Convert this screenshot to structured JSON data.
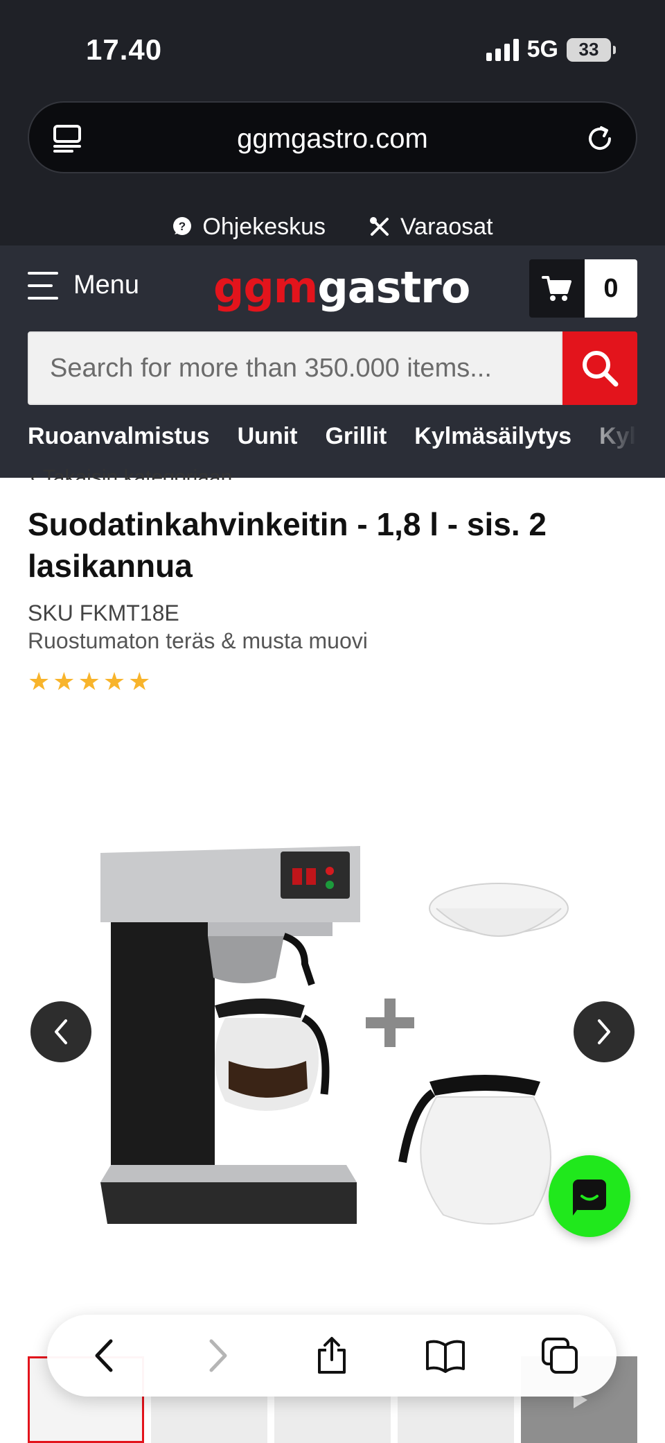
{
  "status_bar": {
    "time": "17.40",
    "network": "5G",
    "battery": "33"
  },
  "browser": {
    "url": "ggmgastro.com"
  },
  "help_links": [
    {
      "label": "Ohjekeskus",
      "icon": "help-chat-icon"
    },
    {
      "label": "Varaosat",
      "icon": "tools-icon"
    }
  ],
  "header": {
    "menu_label": "Menu",
    "logo_part1": "ggm",
    "logo_part2": "gastro",
    "cart_count": "0",
    "search_placeholder": "Search for more than 350.000 items...",
    "categories": [
      "Ruoanvalmistus",
      "Uunit",
      "Grillit",
      "Kylmäsäilytys",
      "Kylmä"
    ]
  },
  "product": {
    "breadcrumb_peek": "‹  Takaisin kategoriaan",
    "title": "Suodatinkahvinkeitin - 1,8 l - sis. 2 lasikannua",
    "sku": "SKU FKMT18E",
    "material": "Ruostumaton teräs & musta muovi",
    "rating_stars": 5
  },
  "colors": {
    "brand_red": "#e3141c",
    "header_bg": "#2b2e37",
    "chat_green": "#20e81c",
    "star": "#f8b42b"
  }
}
